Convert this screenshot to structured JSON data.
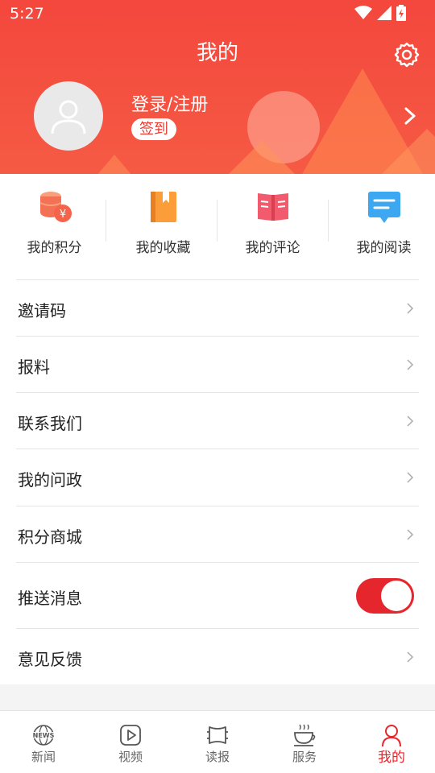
{
  "status": {
    "time": "5:27"
  },
  "header": {
    "title": "我的",
    "login_text": "登录/注册",
    "signin_label": "签到"
  },
  "quick": [
    {
      "label": "我的积分",
      "icon": "coins-icon"
    },
    {
      "label": "我的收藏",
      "icon": "bookmark-book-icon"
    },
    {
      "label": "我的评论",
      "icon": "open-book-icon"
    },
    {
      "label": "我的阅读",
      "icon": "message-icon"
    }
  ],
  "menu": [
    {
      "label": "邀请码"
    },
    {
      "label": "报料"
    },
    {
      "label": "联系我们"
    },
    {
      "label": "我的问政"
    },
    {
      "label": "积分商城"
    },
    {
      "label": "推送消息",
      "toggle": true
    },
    {
      "label": "意见反馈"
    }
  ],
  "nav": [
    {
      "label": "新闻",
      "icon": "news-globe-icon"
    },
    {
      "label": "视频",
      "icon": "play-icon"
    },
    {
      "label": "读报",
      "icon": "newspaper-icon"
    },
    {
      "label": "服务",
      "icon": "coffee-icon"
    },
    {
      "label": "我的",
      "icon": "user-icon",
      "active": true
    }
  ],
  "colors": {
    "accent": "#e6262d",
    "header": "#f4473d"
  }
}
